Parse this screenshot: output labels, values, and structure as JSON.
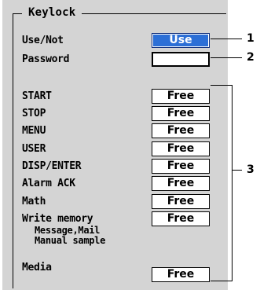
{
  "panel": {
    "title": "Keylock",
    "use_not": {
      "label": "Use/Not",
      "value": "Use"
    },
    "password": {
      "label": "Password",
      "value": ""
    },
    "keys": [
      {
        "label": "START",
        "value": "Free"
      },
      {
        "label": "STOP",
        "value": "Free"
      },
      {
        "label": "MENU",
        "value": "Free"
      },
      {
        "label": "USER",
        "value": "Free"
      },
      {
        "label": "DISP/ENTER",
        "value": "Free"
      },
      {
        "label": "Alarm ACK",
        "value": "Free"
      },
      {
        "label": "Math",
        "value": "Free"
      },
      {
        "label": "Write memory",
        "value": "Free"
      },
      {
        "label": "Media",
        "value": "Free"
      }
    ],
    "write_memory_sub": [
      "Message,Mail",
      "Manual sample"
    ]
  },
  "callouts": [
    "1",
    "2",
    "3"
  ],
  "colors": {
    "panel_bg": "#d4d4d4",
    "selected_bg": "#2c6fd6"
  }
}
